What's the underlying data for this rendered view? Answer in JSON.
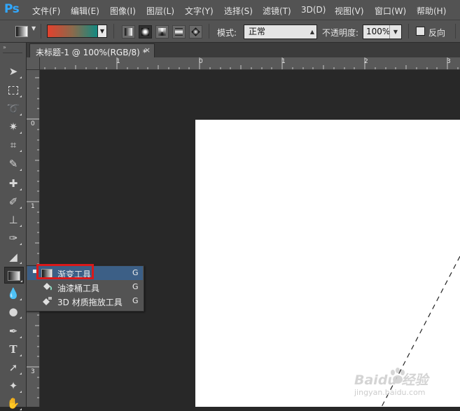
{
  "app": {
    "logo": "Ps"
  },
  "menu": [
    "文件(F)",
    "编辑(E)",
    "图像(I)",
    "图层(L)",
    "文字(Y)",
    "选择(S)",
    "滤镜(T)",
    "3D(D)",
    "视图(V)",
    "窗口(W)",
    "帮助(H)"
  ],
  "options": {
    "gradient_colors": [
      "#e3412d",
      "#108a82"
    ],
    "gradient_types": [
      "linear",
      "radial",
      "angle",
      "reflected",
      "diamond"
    ],
    "active_gradient_type": "radial",
    "mode_label": "模式:",
    "mode_value": "正常",
    "opacity_label": "不透明度:",
    "opacity_value": "100%",
    "reverse_label": "反向",
    "reverse_checked": false
  },
  "document": {
    "tab_title": "未标题-1 @ 100%(RGB/8) *",
    "close_glyph": "×"
  },
  "rulers": {
    "h_labels": [
      "1",
      "0",
      "1",
      "2",
      "3"
    ],
    "v_labels": [
      "0",
      "1",
      "2",
      "3"
    ]
  },
  "toolbox": {
    "grip": "»",
    "tools": [
      "move-tool",
      "marquee-tool",
      "lasso-tool",
      "magic-wand-tool",
      "crop-tool",
      "eyedropper-tool",
      "healing-brush-tool",
      "brush-tool",
      "clone-stamp-tool",
      "history-brush-tool",
      "eraser-tool",
      "gradient-tool",
      "blur-tool",
      "dodge-tool",
      "pen-tool",
      "type-tool",
      "path-selection-tool",
      "shape-tool",
      "hand-tool"
    ]
  },
  "flyout": {
    "items": [
      {
        "label": "渐变工具",
        "key": "G",
        "selected": true,
        "icon": "gradient-icon"
      },
      {
        "label": "油漆桶工具",
        "key": "G",
        "selected": false,
        "icon": "paint-bucket-icon"
      },
      {
        "label": "3D 材质拖放工具",
        "key": "G",
        "selected": false,
        "icon": "3d-material-drop-icon"
      }
    ],
    "current_mark": "▪"
  },
  "colors": {
    "highlight": "#d9191a",
    "selected_item": "#3c5f86",
    "canvas": "#ffffff",
    "pasteboard": "#282828"
  },
  "watermark": {
    "text": "Baidu 经验",
    "sub": "jingyan.baidu.com"
  }
}
